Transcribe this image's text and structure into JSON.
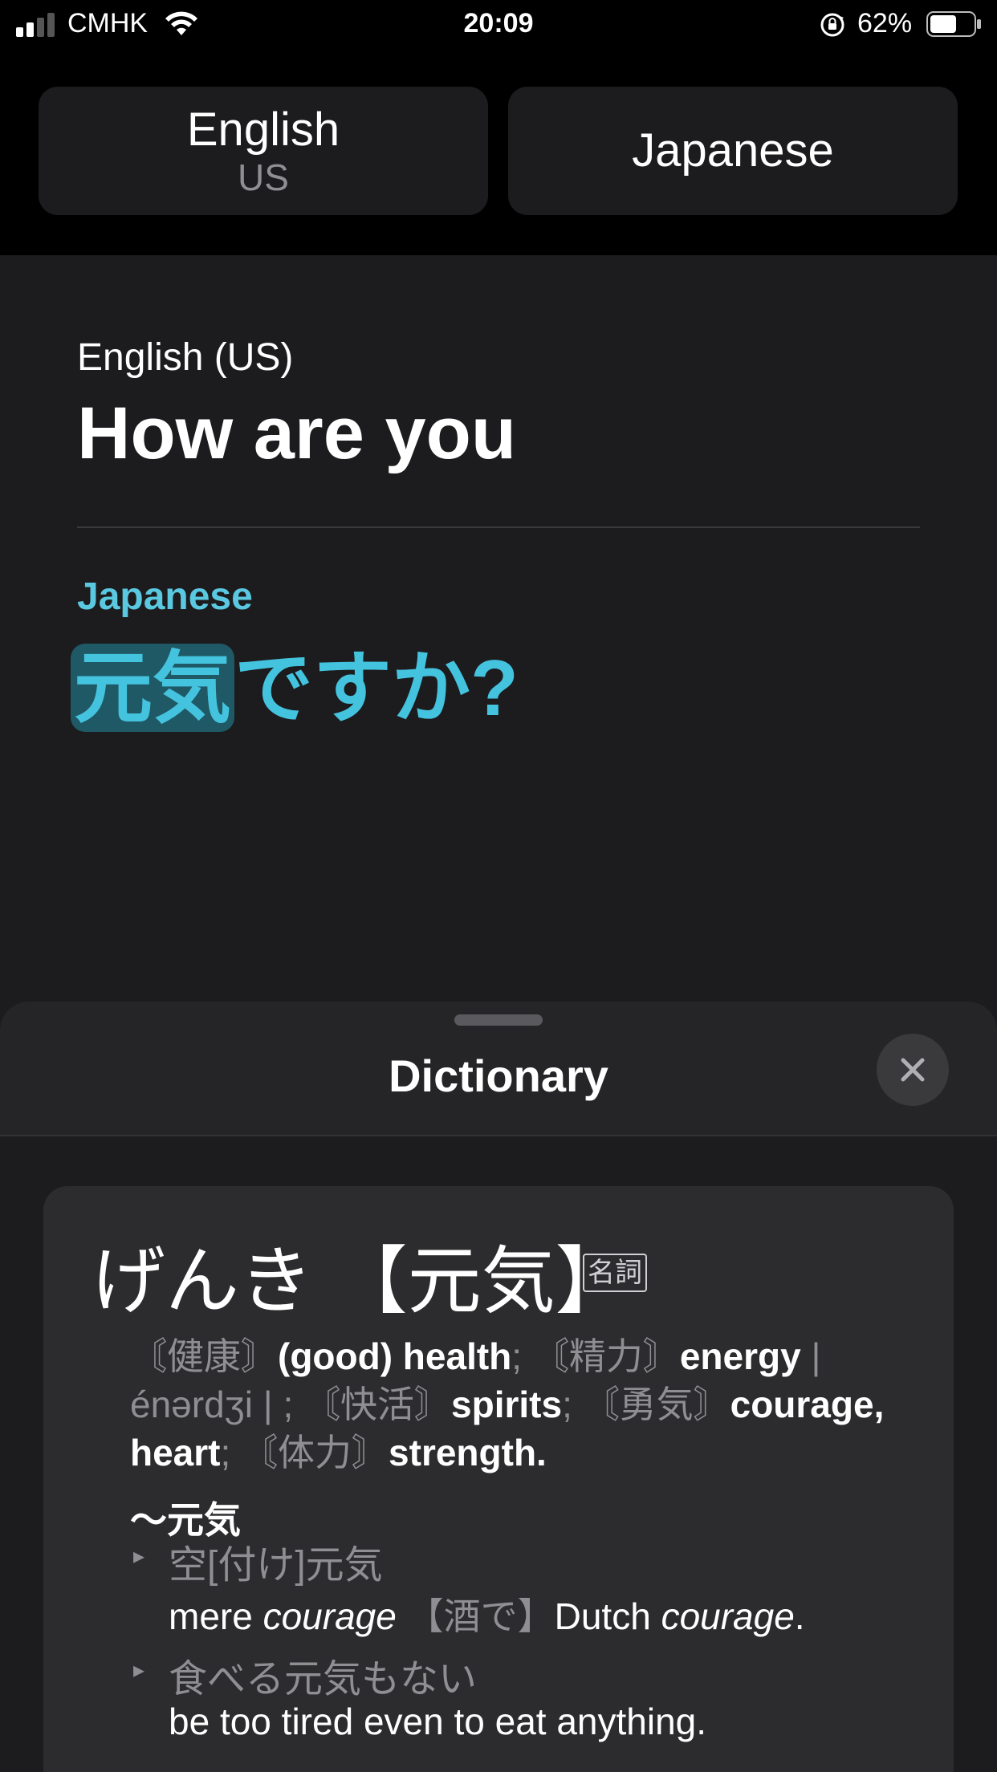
{
  "status_bar": {
    "carrier": "CMHK",
    "time": "20:09",
    "battery_percent": "62%",
    "battery_level": 0.62,
    "icons": [
      "signal-icon",
      "wifi-icon",
      "rotation-lock-icon",
      "battery-icon"
    ]
  },
  "language_bar": {
    "source": {
      "name": "English",
      "region": "US"
    },
    "target": {
      "name": "Japanese"
    }
  },
  "translation": {
    "source_label": "English (US)",
    "source_text": "How are you",
    "target_label": "Japanese",
    "target_highlighted": "元気",
    "target_rest": "ですか?"
  },
  "dictionary": {
    "title": "Dictionary",
    "close_icon": "close-icon",
    "entry": {
      "reading": "げんき",
      "kanji": "【元気】",
      "pos": "名詞",
      "def": {
        "m1": "〘健康〙",
        "t1": "(good) health",
        "s1": "; ",
        "m2": "〘精力〙",
        "t2": "energy",
        "pron": " | énərdʒi | ",
        "s2": "; ",
        "m3": "〘快活〙",
        "t3": "spirits",
        "s3": "; ",
        "m4": "〘勇気〙",
        "t4": "courage, heart",
        "s4": "; ",
        "m5": "〘体力〙",
        "t5": "strength."
      },
      "compound_heading": "～元気",
      "examples": [
        {
          "japanese": "空[付け]元気",
          "en_1": "mere ",
          "en_2": "courage",
          "en_3": " ",
          "en_4": "【酒で】",
          "en_5": "Dutch ",
          "en_6": "courage",
          "en_7": "."
        },
        {
          "japanese": "食べる元気もない",
          "english": "be too tired even to eat anything."
        }
      ]
    }
  }
}
